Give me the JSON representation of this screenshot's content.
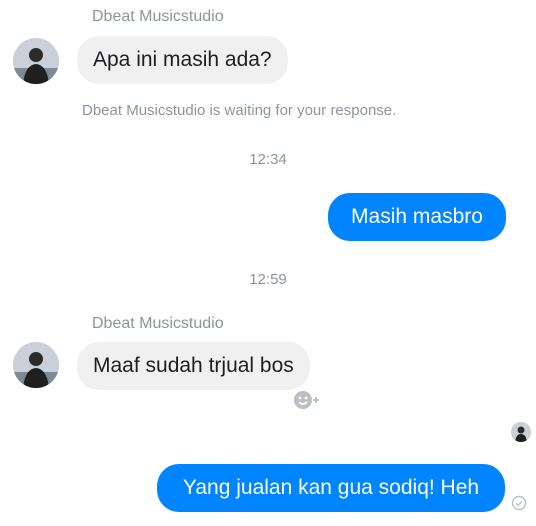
{
  "conversation": {
    "first_sender_name": "Dbeat Musicstudio",
    "msg1": "Apa ini masih ada?",
    "waiting_notice": "Dbeat Musicstudio is waiting for your response.",
    "time1": "12:34",
    "reply1": "Masih masbro",
    "time2": "12:59",
    "second_sender_name": "Dbeat Musicstudio",
    "msg2": "Maaf sudah trjual bos",
    "reply2": "Yang jualan kan gua sodiq! Heh"
  },
  "icons": {
    "reaction": "add-reaction-icon",
    "seen": "seen-avatar-icon",
    "delivered": "delivered-check-icon"
  },
  "colors": {
    "outgoing_bubble": "#0084ff",
    "incoming_bubble": "#f1f0f0",
    "meta_text": "#8d949e"
  }
}
